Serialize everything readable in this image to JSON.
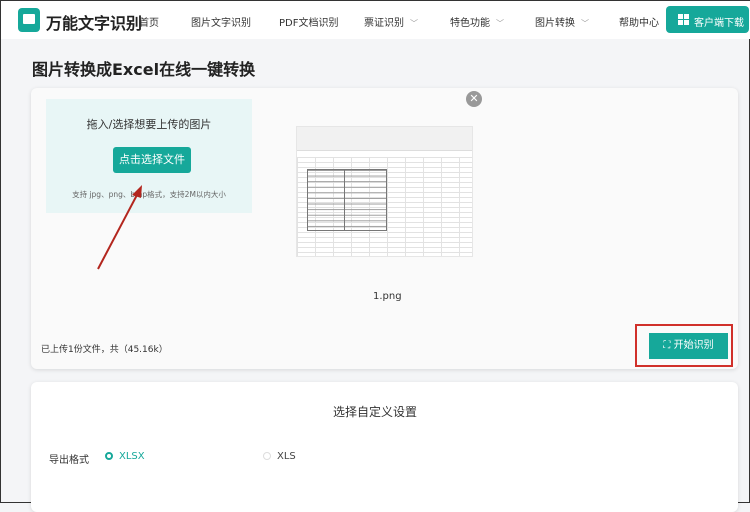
{
  "header": {
    "brand": "万能文字识别",
    "nav": [
      {
        "label": "首页"
      },
      {
        "label": "图片文字识别"
      },
      {
        "label": "PDF文档识别"
      },
      {
        "label": "票证识别",
        "dropdown": true
      },
      {
        "label": "特色功能",
        "dropdown": true
      },
      {
        "label": "图片转换",
        "dropdown": true
      },
      {
        "label": "帮助中心"
      }
    ],
    "download": "客户端下载"
  },
  "page_title": "图片转换成Excel在线一键转换",
  "upload": {
    "prompt": "拖入/选择想要上传的图片",
    "button": "点击选择文件",
    "hint": "支持 jpg、png、bmp格式，支持2M以内大小",
    "file_name": "1.png",
    "status": "已上传1份文件，共（45.16k）",
    "start": "开始识别"
  },
  "settings": {
    "title": "选择自定义设置",
    "format_label": "导出格式",
    "options": [
      {
        "label": "XLSX",
        "selected": true
      },
      {
        "label": "XLS",
        "selected": false
      }
    ]
  },
  "colors": {
    "accent": "#16a89a",
    "highlight": "#d0302a"
  }
}
